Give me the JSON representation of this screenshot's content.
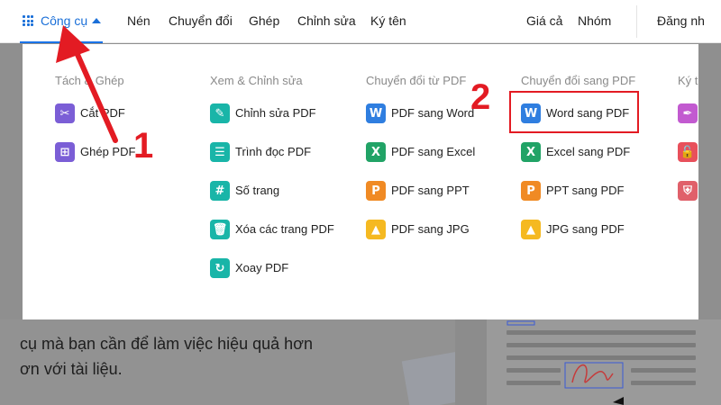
{
  "nav": {
    "tools_label": "Công cụ",
    "items": [
      "Nén",
      "Chuyển đổi",
      "Ghép",
      "Chỉnh sửa",
      "Ký tên"
    ],
    "right": [
      "Giá cả",
      "Nhóm"
    ],
    "login": "Đăng nh"
  },
  "menu": {
    "columns": [
      {
        "heading": "Tách & Ghép",
        "items": [
          {
            "label": "Cắt PDF",
            "icon": "scissors-icon",
            "glyph": "✂"
          },
          {
            "label": "Ghép PDF",
            "icon": "merge-icon",
            "glyph": "⊞"
          }
        ]
      },
      {
        "heading": "Xem & Chỉnh sửa",
        "items": [
          {
            "label": "Chỉnh sửa PDF",
            "icon": "edit-icon",
            "glyph": "✎"
          },
          {
            "label": "Trình đọc PDF",
            "icon": "reader-icon",
            "glyph": "☰"
          },
          {
            "label": "Số trang",
            "icon": "page-number-icon",
            "glyph": "#"
          },
          {
            "label": "Xóa các trang PDF",
            "icon": "trash-icon",
            "glyph": "🗑"
          },
          {
            "label": "Xoay PDF",
            "icon": "rotate-icon",
            "glyph": "↻"
          }
        ]
      },
      {
        "heading": "Chuyển đổi từ PDF",
        "items": [
          {
            "label": "PDF sang Word",
            "icon": "word-icon",
            "glyph": "W"
          },
          {
            "label": "PDF sang Excel",
            "icon": "excel-icon",
            "glyph": "X"
          },
          {
            "label": "PDF sang PPT",
            "icon": "ppt-icon",
            "glyph": "P"
          },
          {
            "label": "PDF sang JPG",
            "icon": "image-icon",
            "glyph": "▲"
          }
        ]
      },
      {
        "heading": "Chuyển đổi sang PDF",
        "items": [
          {
            "label": "Word sang PDF",
            "icon": "word-icon",
            "glyph": "W"
          },
          {
            "label": "Excel sang PDF",
            "icon": "excel-icon",
            "glyph": "X"
          },
          {
            "label": "PPT sang PDF",
            "icon": "ppt-icon",
            "glyph": "P"
          },
          {
            "label": "JPG sang PDF",
            "icon": "image-icon",
            "glyph": "▲"
          }
        ]
      },
      {
        "heading": "Ký tê",
        "items": [
          {
            "label": "",
            "icon": "sign-icon",
            "glyph": "✒"
          },
          {
            "label": "",
            "icon": "unlock-icon",
            "glyph": "🔓"
          },
          {
            "label": "",
            "icon": "shield-icon",
            "glyph": "⛨"
          }
        ]
      }
    ]
  },
  "annotations": {
    "step1": "1",
    "step2": "2"
  },
  "background": {
    "line1": "cụ mà bạn cần để làm việc hiệu quả hơn",
    "line2": "ơn với tài liệu."
  },
  "colors": {
    "accent": "#1a6fd8",
    "annotation": "#e31b23"
  }
}
